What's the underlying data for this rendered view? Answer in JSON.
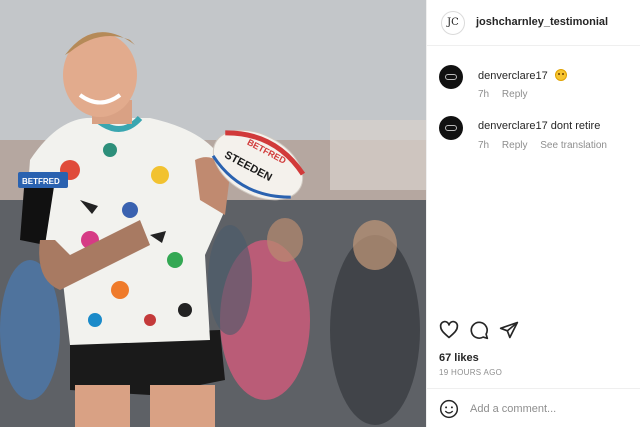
{
  "post": {
    "username": "joshcharnley_testimonial",
    "avatar_text": "JC",
    "photo_alt": "Rugby player laughing while holding a Steeden rugby ball"
  },
  "photo_text": {
    "ball_brand_1": "BETFRED",
    "ball_brand_2": "STEEDEN",
    "shirt_sponsor": "BETFRED"
  },
  "comments": [
    {
      "user": "denverclare17",
      "text": "",
      "emoji": "smiley-face",
      "time": "7h",
      "reply": "Reply",
      "translate": ""
    },
    {
      "user": "denverclare17",
      "text": "dont retire",
      "emoji": "",
      "time": "7h",
      "reply": "Reply",
      "translate": "See translation"
    }
  ],
  "actions": {
    "icons": [
      "heart-icon",
      "comment-icon",
      "share-icon"
    ]
  },
  "likes": "67 likes",
  "time_ago": "19 HOURS AGO",
  "add_comment": {
    "placeholder": "Add a comment...",
    "icon": "emoji-icon"
  }
}
